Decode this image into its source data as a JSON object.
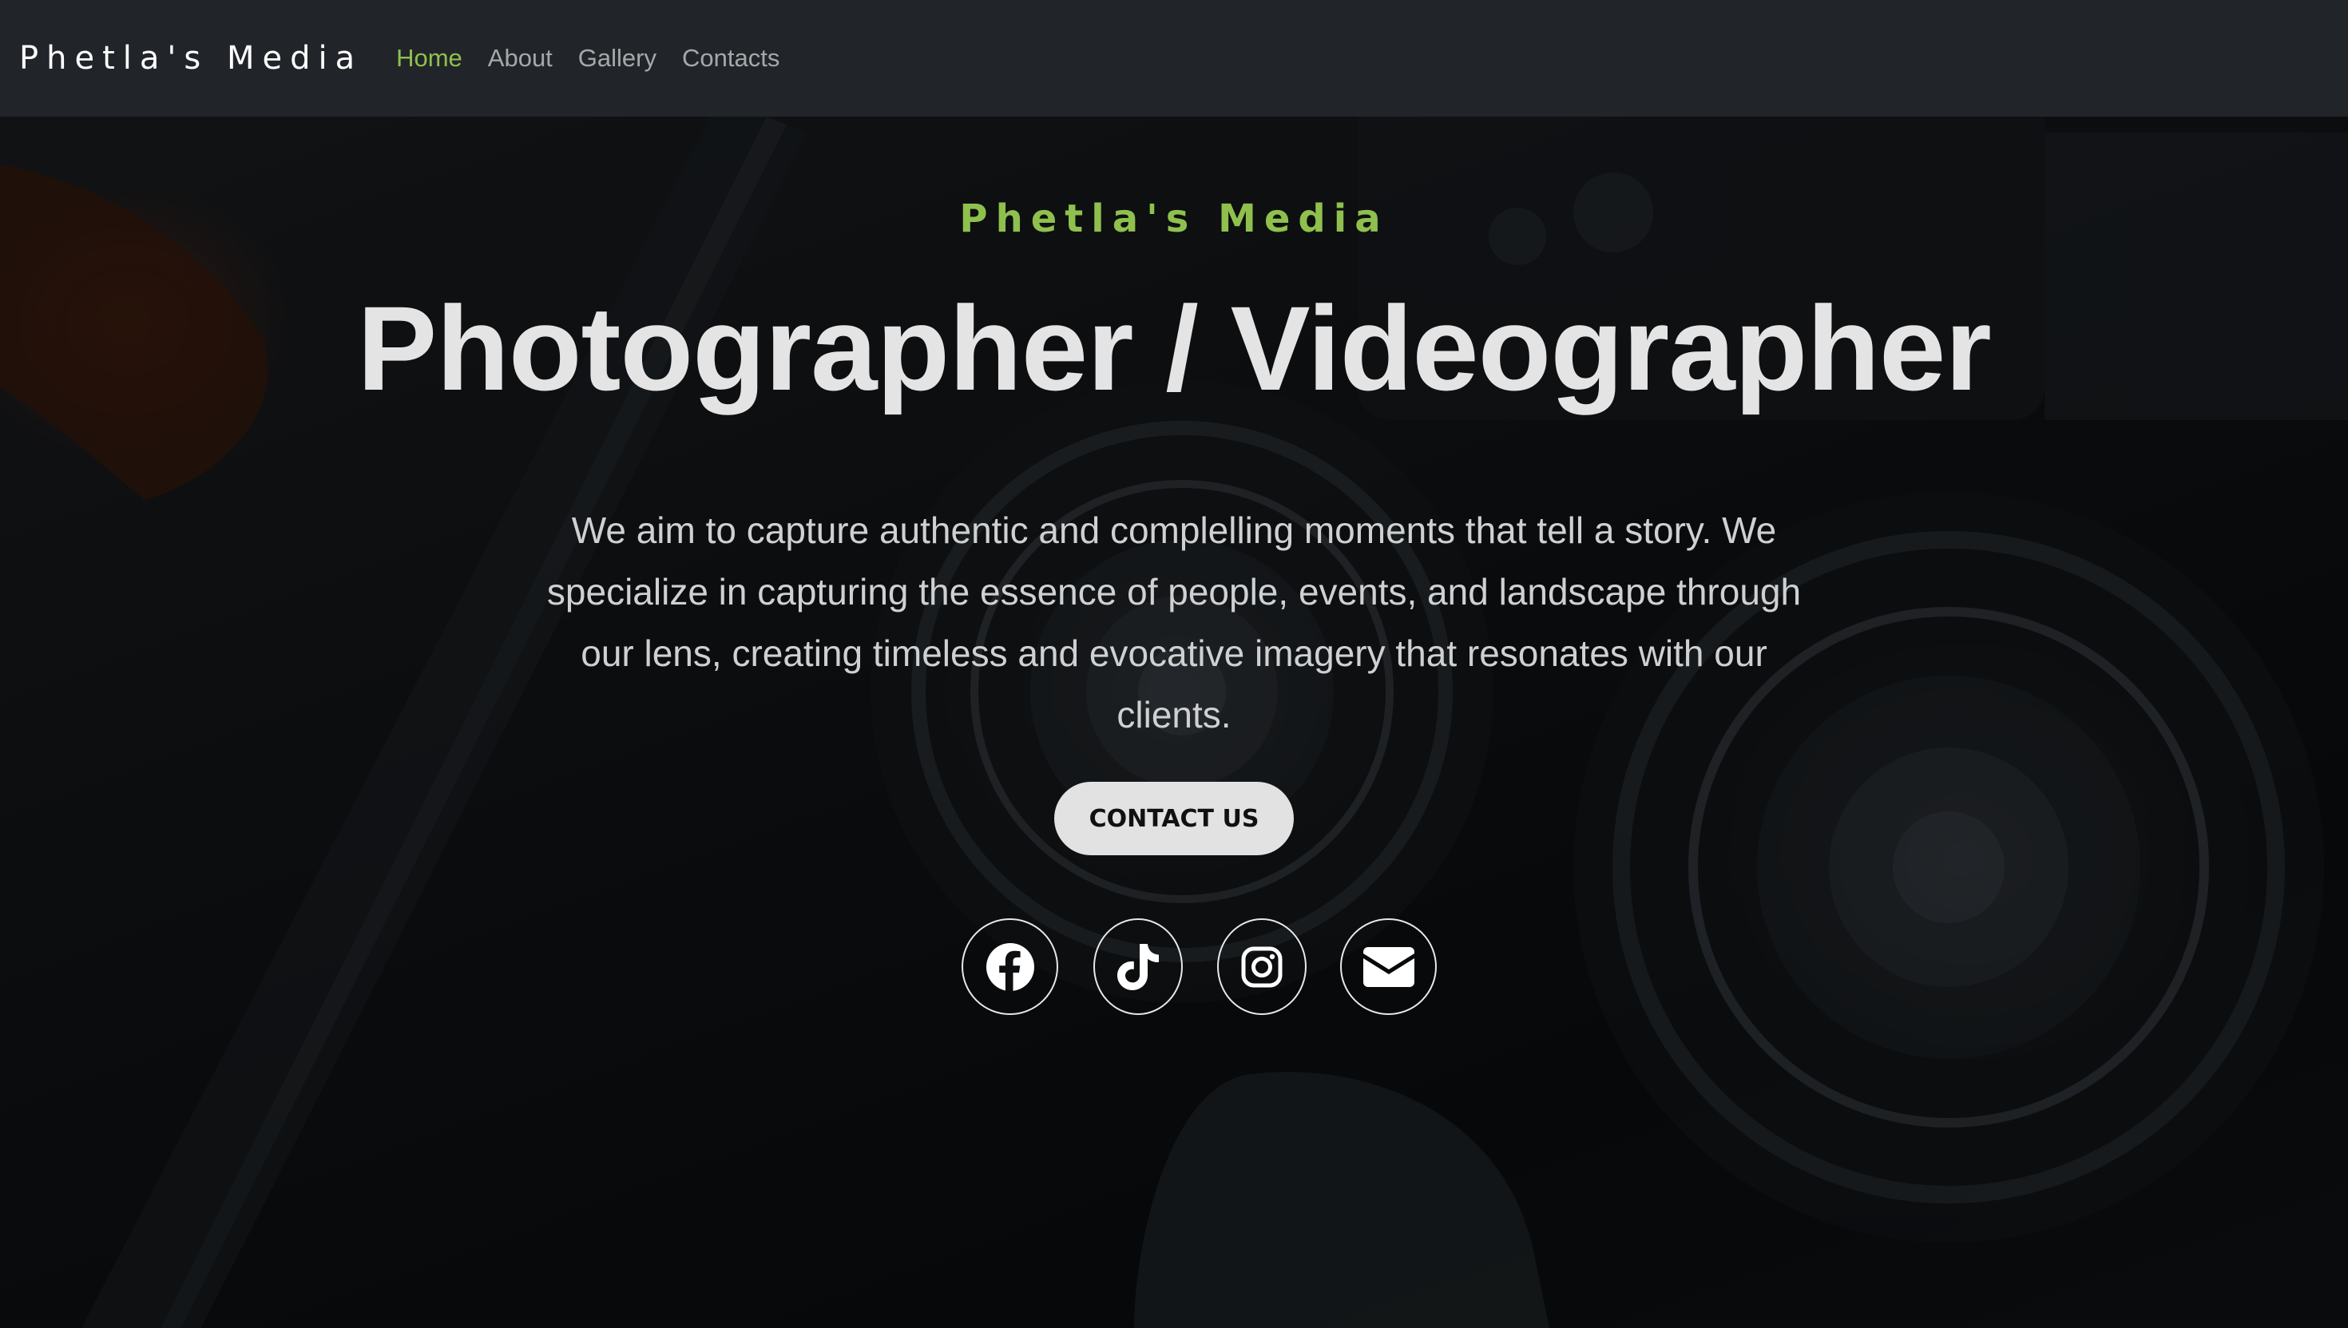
{
  "navbar": {
    "brand": "Phetla's Media",
    "links": [
      {
        "label": "Home",
        "active": true
      },
      {
        "label": "About",
        "active": false
      },
      {
        "label": "Gallery",
        "active": false
      },
      {
        "label": "Contacts",
        "active": false
      }
    ]
  },
  "hero": {
    "subtitle": "Phetla's Media",
    "title": "Photographer / Videographer",
    "description": "We aim to capture authentic and complelling moments that tell a story. We specialize in capturing the essence of people, events, and landscape through our lens, creating timeless and evocative imagery that resonates with our clients.",
    "cta_label": "CONTACT US",
    "background_image": "dark photo of camera lenses and a Manfrotto tripod"
  },
  "social": [
    {
      "icon": "facebook-icon"
    },
    {
      "icon": "tiktok-icon"
    },
    {
      "icon": "instagram-icon"
    },
    {
      "icon": "envelope-icon"
    }
  ],
  "colors": {
    "navbar_bg": "#212529",
    "accent": "#8fc04d",
    "nav_link": "rgba(255,255,255,0.60)",
    "title": "#e4e4e4",
    "button_bg": "#e2e2e2"
  }
}
